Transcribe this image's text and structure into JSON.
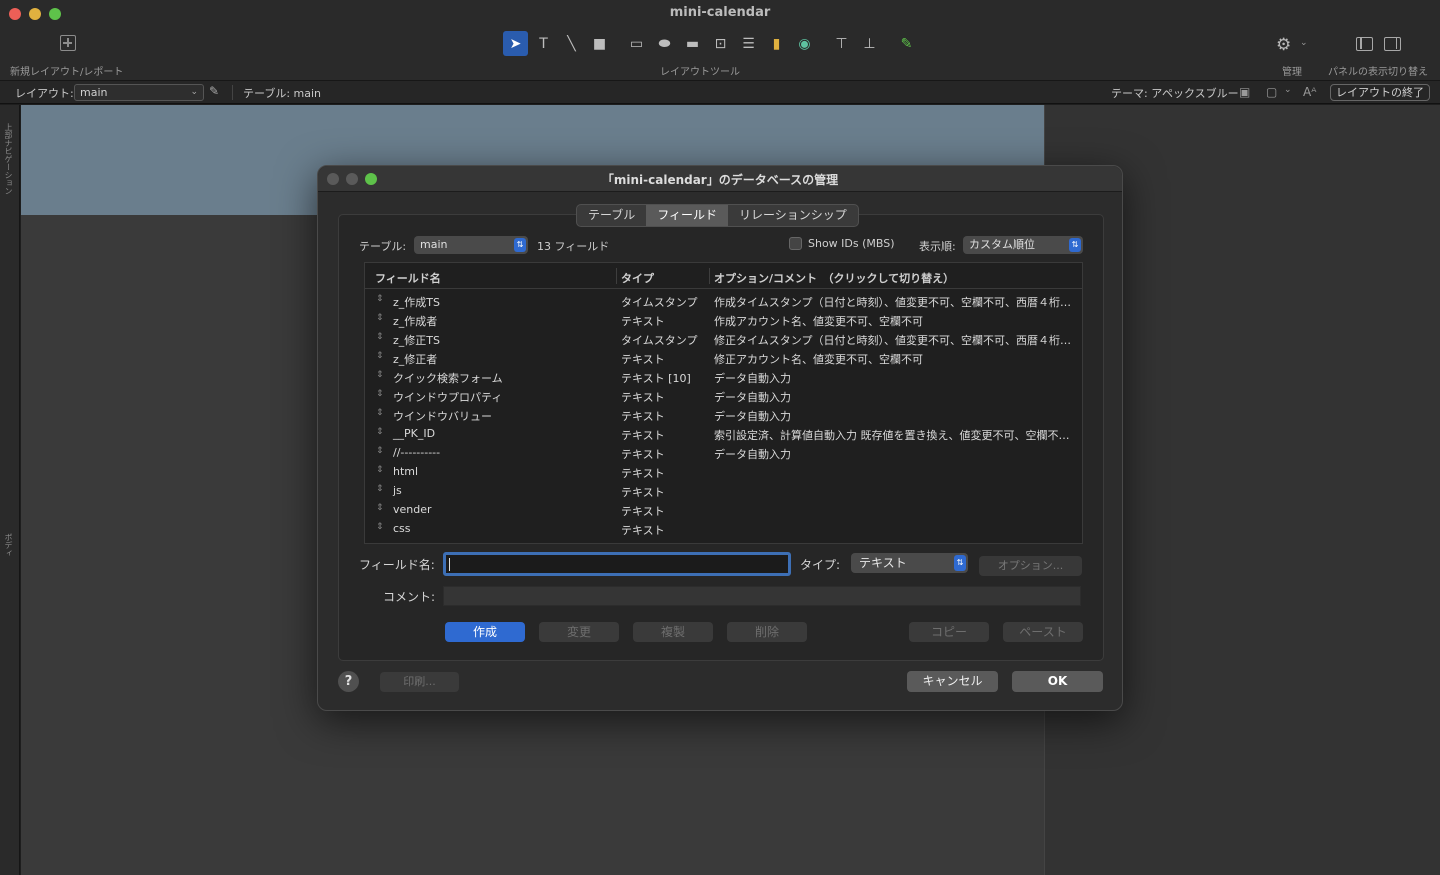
{
  "window": {
    "title": "mini-calendar"
  },
  "toolbar": {
    "new_layout_label": "新規レイアウト/レポート",
    "layout_tools_label": "レイアウトツール",
    "manage_label": "管理",
    "panel_toggle_label": "パネルの表示切り替え"
  },
  "layoutbar": {
    "layout_label": "レイアウト:",
    "layout_value": "main",
    "table_text": "テーブル: main",
    "theme_text": "テーマ: アペックスブルー",
    "exit_label": "レイアウトの終了"
  },
  "canvas": {
    "top_nav_label": "上部ナビゲーション",
    "body_label": "ボディ"
  },
  "dialog": {
    "title": "「mini-calendar」のデータベースの管理",
    "tabs": [
      {
        "label": "テーブル"
      },
      {
        "label": "フィールド"
      },
      {
        "label": "リレーションシップ"
      }
    ],
    "table_label": "テーブル:",
    "table_value": "main",
    "field_count": "13 フィールド",
    "show_ids_label": "Show IDs (MBS)",
    "order_label": "表示順:",
    "order_value": "カスタム順位",
    "columns": {
      "name": "フィールド名",
      "type": "タイプ",
      "options": "オプション/コメント　（クリックして切り替え）"
    },
    "fields": [
      {
        "name": "z_作成TS",
        "type": "タイムスタンプ",
        "options": "作成タイムスタンプ（日付と時刻）、値変更不可、空欄不可、西暦４桁の日付"
      },
      {
        "name": "z_作成者",
        "type": "テキスト",
        "options": "作成アカウント名、値変更不可、空欄不可"
      },
      {
        "name": "z_修正TS",
        "type": "タイムスタンプ",
        "options": "修正タイムスタンプ（日付と時刻）、値変更不可、空欄不可、西暦４桁の日付"
      },
      {
        "name": "z_修正者",
        "type": "テキスト",
        "options": "修正アカウント名、値変更不可、空欄不可"
      },
      {
        "name": "クイック検索フォーム",
        "type": "テキスト [10]",
        "options": "データ自動入力"
      },
      {
        "name": "ウインドウプロパティ",
        "type": "テキスト",
        "options": "データ自動入力"
      },
      {
        "name": "ウインドウバリュー",
        "type": "テキスト",
        "options": "データ自動入力"
      },
      {
        "name": "__PK_ID",
        "type": "テキスト",
        "options": "索引設定済、計算値自動入力 既存値を置き換え、値変更不可、空欄不可、..."
      },
      {
        "name": "//----------",
        "type": "テキスト",
        "options": "データ自動入力"
      },
      {
        "name": "html",
        "type": "テキスト",
        "options": ""
      },
      {
        "name": "js",
        "type": "テキスト",
        "options": ""
      },
      {
        "name": "vender",
        "type": "テキスト",
        "options": ""
      },
      {
        "name": "css",
        "type": "テキスト",
        "options": ""
      }
    ],
    "field_name_label": "フィールド名:",
    "field_name_value": "",
    "type_label": "タイプ:",
    "type_value": "テキスト",
    "options_button": "オプション...",
    "comment_label": "コメント:",
    "comment_value": "",
    "buttons": {
      "create": "作成",
      "change": "変更",
      "duplicate": "複製",
      "delete": "削除",
      "copy": "コピー",
      "paste": "ペースト",
      "print": "印刷...",
      "cancel": "キャンセル",
      "ok": "OK"
    }
  }
}
